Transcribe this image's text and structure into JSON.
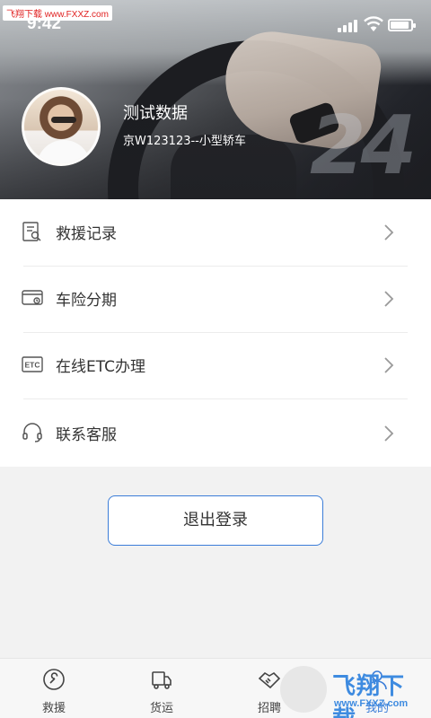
{
  "watermark_top": "飞翔下载 www.FXXZ.com",
  "status_bar": {
    "time": "9:42"
  },
  "profile": {
    "name": "测试数据",
    "vehicle": "京W123123--小型轿车"
  },
  "menu": {
    "items": [
      {
        "label": "救援记录",
        "icon": "rescue-record-icon"
      },
      {
        "label": "车险分期",
        "icon": "insurance-installment-icon"
      },
      {
        "label": "在线ETC办理",
        "icon": "etc-icon"
      },
      {
        "label": "联系客服",
        "icon": "headset-icon"
      }
    ]
  },
  "logout_label": "退出登录",
  "tabbar": {
    "tabs": [
      {
        "label": "救援",
        "icon": "wrench-icon"
      },
      {
        "label": "货运",
        "icon": "truck-icon"
      },
      {
        "label": "招聘",
        "icon": "handshake-icon"
      },
      {
        "label": "我的",
        "icon": "user-icon"
      }
    ]
  },
  "watermark_bottom": {
    "name": "飞翔下载",
    "url": "www.FXXZ.com"
  },
  "colors": {
    "accent": "#3b7dd8",
    "background": "#f2f2f2"
  }
}
